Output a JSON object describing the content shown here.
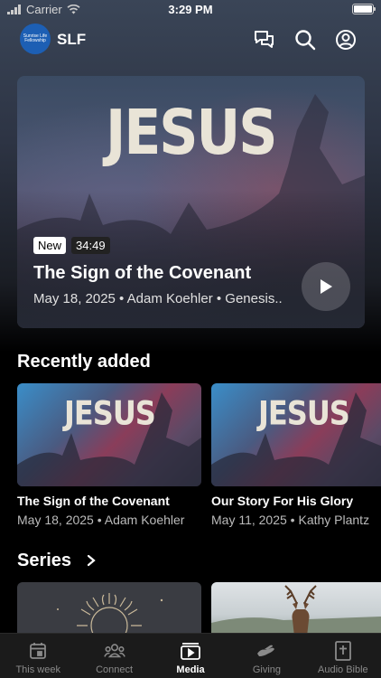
{
  "status_bar": {
    "carrier": "Carrier",
    "time": "3:29 PM"
  },
  "header": {
    "app_name": "SLF",
    "logo_text": "Sunrise Life Fellowship"
  },
  "hero": {
    "art_text": "JESUS",
    "badge_new": "New",
    "duration": "34:49",
    "title": "The Sign of the Covenant",
    "meta": "May 18, 2025 • Adam Koehler • Genesis..."
  },
  "recently_added": {
    "title": "Recently added",
    "items": [
      {
        "art_text": "JESUS",
        "title": "The Sign of the Covenant",
        "meta": "May 18, 2025 • Adam Koehler"
      },
      {
        "art_text": "JESUS",
        "title": "Our Story For His Glory",
        "meta": "May 11, 2025 • Kathy Plantz"
      }
    ]
  },
  "series": {
    "title": "Series"
  },
  "tabs": [
    {
      "label": "This week",
      "icon": "calendar-icon"
    },
    {
      "label": "Connect",
      "icon": "people-icon"
    },
    {
      "label": "Media",
      "icon": "play-box-icon"
    },
    {
      "label": "Giving",
      "icon": "giving-hand-icon"
    },
    {
      "label": "Audio Bible",
      "icon": "bible-icon"
    }
  ],
  "active_tab": "Media"
}
